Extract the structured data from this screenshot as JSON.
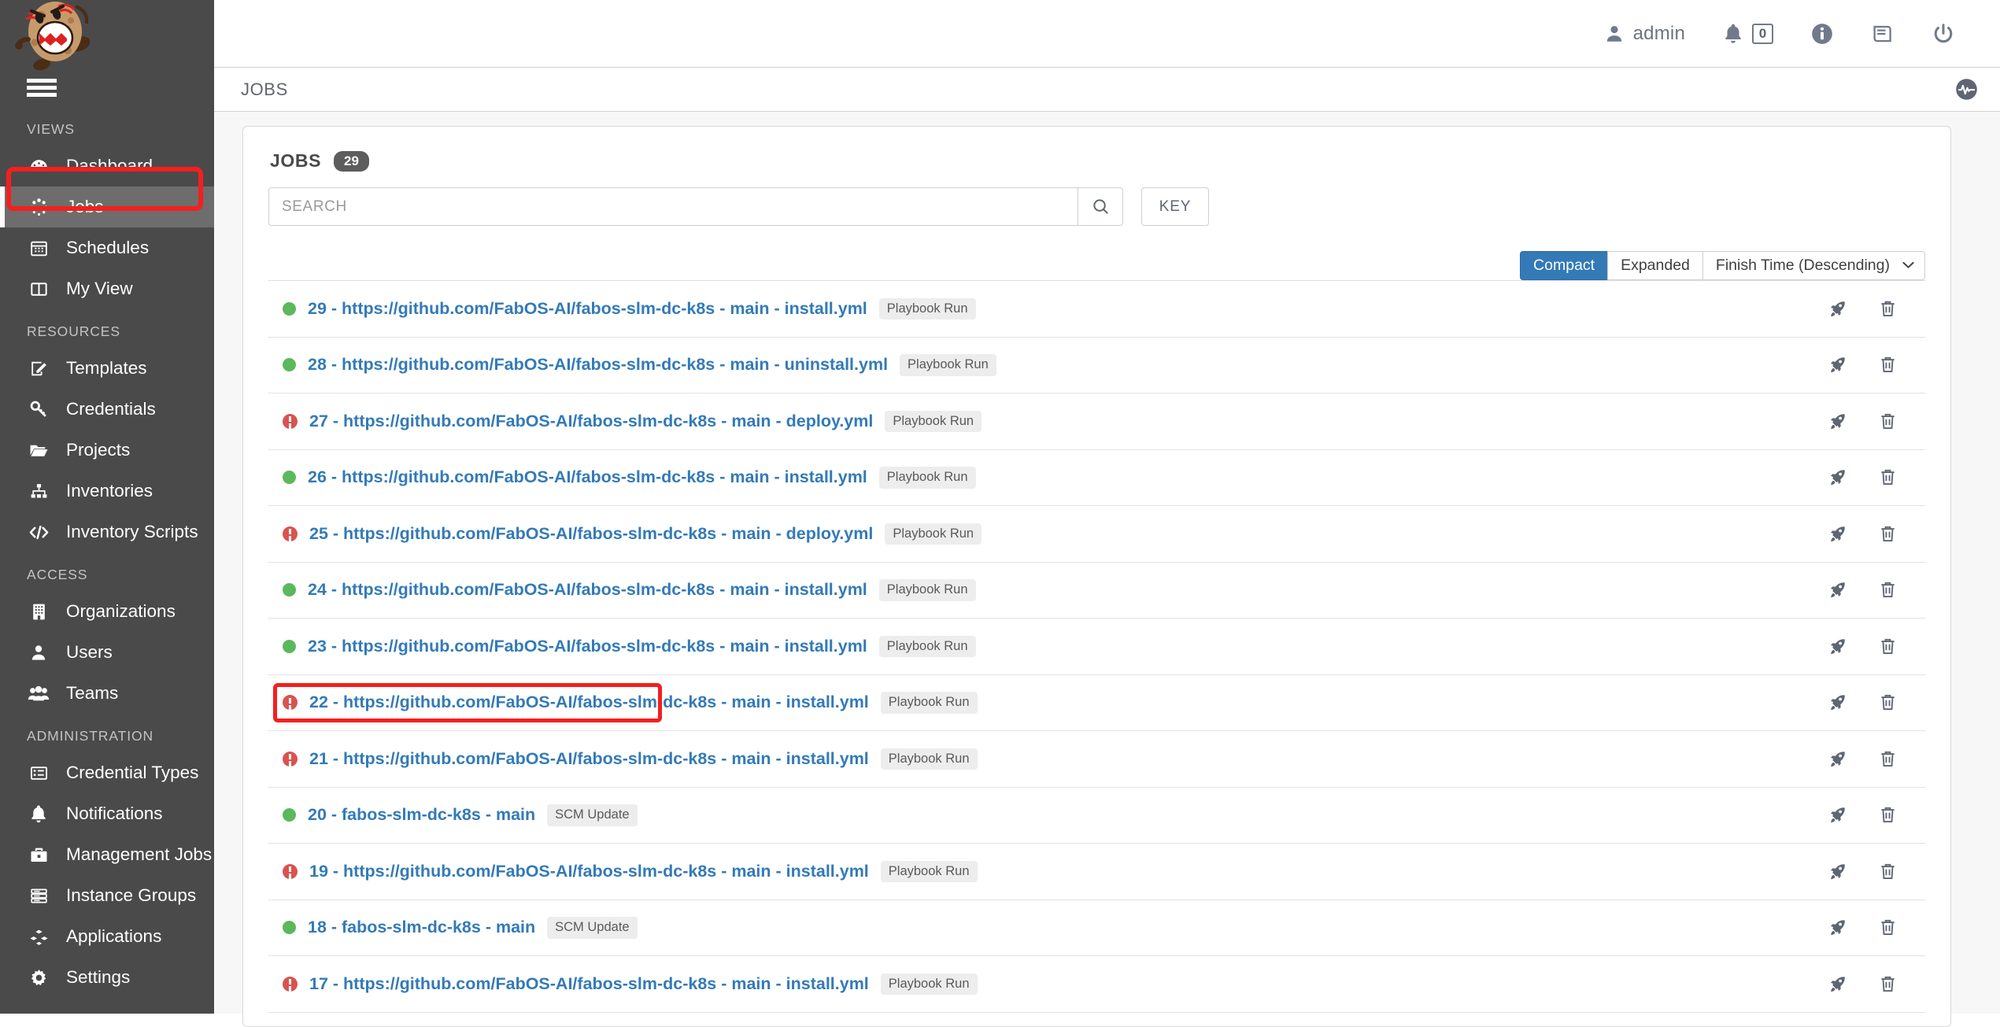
{
  "topbar": {
    "user_label": "admin",
    "notifications_count": "0",
    "icons": [
      "user-icon",
      "bell-icon",
      "info-icon",
      "book-icon",
      "power-icon"
    ]
  },
  "breadcrumb": {
    "text": "JOBS",
    "activity_icon": "activity-stream-icon"
  },
  "sidebar": {
    "sections": [
      {
        "title": "VIEWS",
        "items": [
          {
            "label": "Dashboard",
            "icon": "dashboard-icon",
            "active": false
          },
          {
            "label": "Jobs",
            "icon": "jobs-spinner-icon",
            "active": true
          },
          {
            "label": "Schedules",
            "icon": "calendar-icon",
            "active": false
          },
          {
            "label": "My View",
            "icon": "columns-icon",
            "active": false
          }
        ]
      },
      {
        "title": "RESOURCES",
        "items": [
          {
            "label": "Templates",
            "icon": "edit-square-icon",
            "active": false
          },
          {
            "label": "Credentials",
            "icon": "key-icon",
            "active": false
          },
          {
            "label": "Projects",
            "icon": "folder-open-icon",
            "active": false
          },
          {
            "label": "Inventories",
            "icon": "sitemap-icon",
            "active": false
          },
          {
            "label": "Inventory Scripts",
            "icon": "code-icon",
            "active": false
          }
        ]
      },
      {
        "title": "ACCESS",
        "items": [
          {
            "label": "Organizations",
            "icon": "building-icon",
            "active": false
          },
          {
            "label": "Users",
            "icon": "user-icon",
            "active": false
          },
          {
            "label": "Teams",
            "icon": "users-icon",
            "active": false
          }
        ]
      },
      {
        "title": "ADMINISTRATION",
        "items": [
          {
            "label": "Credential Types",
            "icon": "list-alt-icon",
            "active": false
          },
          {
            "label": "Notifications",
            "icon": "bell-icon",
            "active": false
          },
          {
            "label": "Management Jobs",
            "icon": "briefcase-icon",
            "active": false
          },
          {
            "label": "Instance Groups",
            "icon": "server-icon",
            "active": false
          },
          {
            "label": "Applications",
            "icon": "cubes-icon",
            "active": false
          },
          {
            "label": "Settings",
            "icon": "gear-icon",
            "active": false
          }
        ]
      }
    ]
  },
  "main": {
    "card_title": "JOBS",
    "count": "29",
    "search": {
      "placeholder": "SEARCH",
      "value": "",
      "icon": "search-icon"
    },
    "key_button": "KEY",
    "view_toggle": {
      "compact": "Compact",
      "expanded": "Expanded",
      "active": "Compact"
    },
    "sort": {
      "label": "Finish Time (Descending)",
      "icon": "chevron-down-icon"
    },
    "row_actions": {
      "relaunch": "rocket-icon",
      "delete": "trash-icon"
    },
    "jobs": [
      {
        "id": "29",
        "name": "29 - https://github.com/FabOS-AI/fabos-slm-dc-k8s - main - install.yml",
        "type": "Playbook Run",
        "status": "success"
      },
      {
        "id": "28",
        "name": "28 - https://github.com/FabOS-AI/fabos-slm-dc-k8s - main - uninstall.yml",
        "type": "Playbook Run",
        "status": "success"
      },
      {
        "id": "27",
        "name": "27 - https://github.com/FabOS-AI/fabos-slm-dc-k8s - main - deploy.yml",
        "type": "Playbook Run",
        "status": "failed"
      },
      {
        "id": "26",
        "name": "26 - https://github.com/FabOS-AI/fabos-slm-dc-k8s - main - install.yml",
        "type": "Playbook Run",
        "status": "success"
      },
      {
        "id": "25",
        "name": "25 - https://github.com/FabOS-AI/fabos-slm-dc-k8s - main - deploy.yml",
        "type": "Playbook Run",
        "status": "failed"
      },
      {
        "id": "24",
        "name": "24 - https://github.com/FabOS-AI/fabos-slm-dc-k8s - main - install.yml",
        "type": "Playbook Run",
        "status": "success"
      },
      {
        "id": "23",
        "name": "23 - https://github.com/FabOS-AI/fabos-slm-dc-k8s - main - install.yml",
        "type": "Playbook Run",
        "status": "success"
      },
      {
        "id": "22",
        "name": "22 - https://github.com/FabOS-AI/fabos-slm-dc-k8s - main - install.yml",
        "type": "Playbook Run",
        "status": "failed",
        "highlighted": true
      },
      {
        "id": "21",
        "name": "21 - https://github.com/FabOS-AI/fabos-slm-dc-k8s - main - install.yml",
        "type": "Playbook Run",
        "status": "failed"
      },
      {
        "id": "20",
        "name": "20 - fabos-slm-dc-k8s - main",
        "type": "SCM Update",
        "status": "success"
      },
      {
        "id": "19",
        "name": "19 - https://github.com/FabOS-AI/fabos-slm-dc-k8s - main - install.yml",
        "type": "Playbook Run",
        "status": "failed"
      },
      {
        "id": "18",
        "name": "18 - fabos-slm-dc-k8s - main",
        "type": "SCM Update",
        "status": "success"
      },
      {
        "id": "17",
        "name": "17 - https://github.com/FabOS-AI/fabos-slm-dc-k8s - main - install.yml",
        "type": "Playbook Run",
        "status": "failed"
      }
    ]
  },
  "colors": {
    "accent_blue": "#337ab7",
    "success_green": "#5cb85c",
    "error_red": "#d9534f",
    "annotation_red": "#f41f1f",
    "sidebar_bg": "#4a4a4a"
  }
}
